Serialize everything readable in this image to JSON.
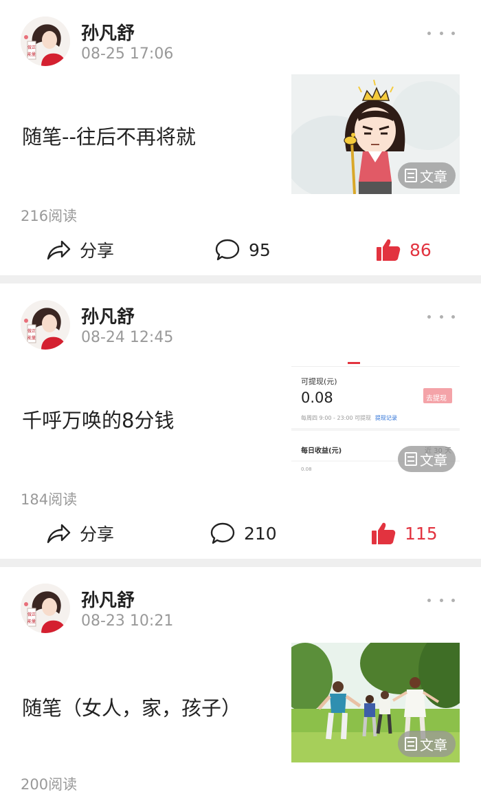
{
  "posts": [
    {
      "author": "孙凡舒",
      "time": "08-25 17:06",
      "title": "随笔--往后不再将就",
      "badge": "文章",
      "reads": "216阅读",
      "share_label": "分享",
      "comments": "95",
      "likes": "86"
    },
    {
      "author": "孙凡舒",
      "time": "08-24 12:45",
      "title": "千呼万唤的8分钱",
      "badge": "文章",
      "reads": "184阅读",
      "share_label": "分享",
      "comments": "210",
      "likes": "115",
      "thumb": {
        "withdrawable_label": "可提现(元)",
        "amount": "0.08",
        "withdraw_button": "去提现",
        "schedule": "每周四 9:00 - 23:00 可提现",
        "record_link": "提现记录",
        "daily_label": "每日收益(元)",
        "range": "近 30 天",
        "axis_value": "0.08"
      }
    },
    {
      "author": "孙凡舒",
      "time": "08-23 10:21",
      "title": "随笔（女人，家，孩子）",
      "badge": "文章",
      "reads": "200阅读"
    }
  ],
  "avatar_seal": "做正能量",
  "colors": {
    "like_red": "#e2333f",
    "muted_text": "#999999",
    "divider": "#efefef",
    "badge_bg": "rgba(150,150,150,0.75)"
  },
  "icons": {
    "share": "share-arrow-icon",
    "comment": "speech-bubble-icon",
    "like": "thumbs-up-icon",
    "more": "more-dots-icon",
    "badge": "article-doc-icon"
  }
}
